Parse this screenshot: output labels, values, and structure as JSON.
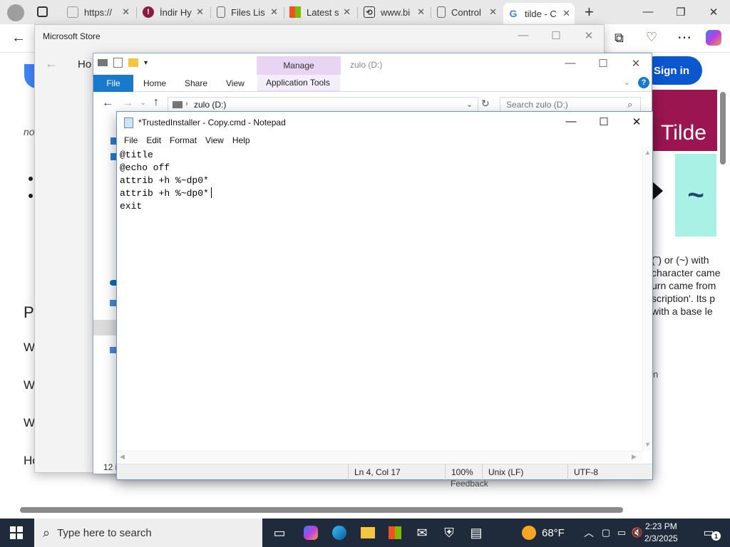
{
  "browser": {
    "tabs": [
      {
        "label": "https://",
        "favicon": "generic-page-icon"
      },
      {
        "label": "İndir Hy",
        "favicon": "shield-icon"
      },
      {
        "label": "Files Lis",
        "favicon": "document-icon"
      },
      {
        "label": "Latest s",
        "favicon": "microsoft-icon"
      },
      {
        "label": "www.bi",
        "favicon": "translate-icon"
      },
      {
        "label": "Control",
        "favicon": "document-icon"
      },
      {
        "label": "tilde - C",
        "favicon": "google-icon"
      }
    ],
    "new_tab_symbol": "+",
    "sign_in": "Sign in"
  },
  "webpage": {
    "home_partial": "Ho",
    "italic_partial": "no",
    "section_partial": "P",
    "list_partials": [
      "Wh",
      "Wh",
      "Wh",
      "Ho"
    ],
    "image_text": "Tilde",
    "card_symbol": "~",
    "snippet_lines": [
      "(˜) or (~) with",
      "character came",
      "urn came from",
      "scription'. Its p",
      "with a base le"
    ],
    "partial_n": "n",
    "feedback": "Feedback"
  },
  "store_window": {
    "title": "Microsoft Store"
  },
  "explorer": {
    "manage_tab": "Manage",
    "title": "zulo (D:)",
    "ribbon_tabs": [
      "File",
      "Home",
      "Share",
      "View",
      "Application Tools"
    ],
    "address": "zulo (D:)",
    "search_placeholder": "Search zulo (D:)",
    "status": "12 i"
  },
  "notepad": {
    "title": "*TrustedInstaller - Copy.cmd - Notepad",
    "menu": [
      "File",
      "Edit",
      "Format",
      "View",
      "Help"
    ],
    "content": "@title\n@echo off\nattrib +h %~dp0*\nattrib +h %~dp0*\nexit",
    "status": {
      "position": "Ln 4, Col 17",
      "zoom": "100%",
      "line_ending": "Unix (LF)",
      "encoding": "UTF-8"
    }
  },
  "taskbar": {
    "search_placeholder": "Type here to search",
    "weather": "68°F",
    "time": "2:23 PM",
    "date": "2/3/2025",
    "notification_count": "1"
  }
}
